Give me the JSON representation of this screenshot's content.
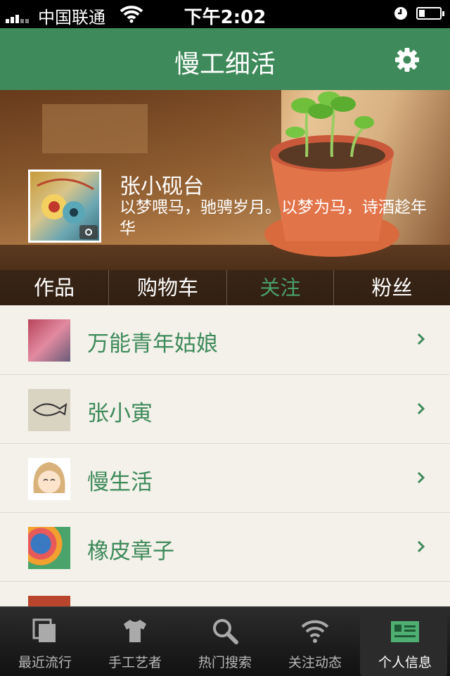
{
  "status_bar": {
    "carrier": "中国联通",
    "time": "下午2:02"
  },
  "nav": {
    "title": "慢工细活",
    "settings_icon": "gear-icon"
  },
  "profile": {
    "name": "张小砚台",
    "motto": "以梦喂马，驰骋岁月。以梦为马，诗酒趁年华",
    "tabs": [
      {
        "label": "作品"
      },
      {
        "label": "购物车"
      },
      {
        "label": "关注",
        "active": true
      },
      {
        "label": "粉丝"
      }
    ]
  },
  "following": [
    {
      "name": "万能青年姑娘",
      "thumb_color": "#b7445a"
    },
    {
      "name": "张小寅",
      "thumb_color": "#d9d3c2"
    },
    {
      "name": "慢生活",
      "thumb_color": "#f0d7b2"
    },
    {
      "name": "橡皮章子",
      "thumb_color": "#3a78c2"
    },
    {
      "name": "",
      "thumb_color": "#b8452c"
    }
  ],
  "tabbar": [
    {
      "label": "最近流行",
      "icon": "layers-icon"
    },
    {
      "label": "手工艺者",
      "icon": "tshirt-icon"
    },
    {
      "label": "热门搜索",
      "icon": "search-icon"
    },
    {
      "label": "关注动态",
      "icon": "wifi-icon"
    },
    {
      "label": "个人信息",
      "icon": "profile-card-icon",
      "active": true
    }
  ],
  "colors": {
    "accent": "#3e8a5a",
    "list_bg": "#f3f1ea"
  }
}
